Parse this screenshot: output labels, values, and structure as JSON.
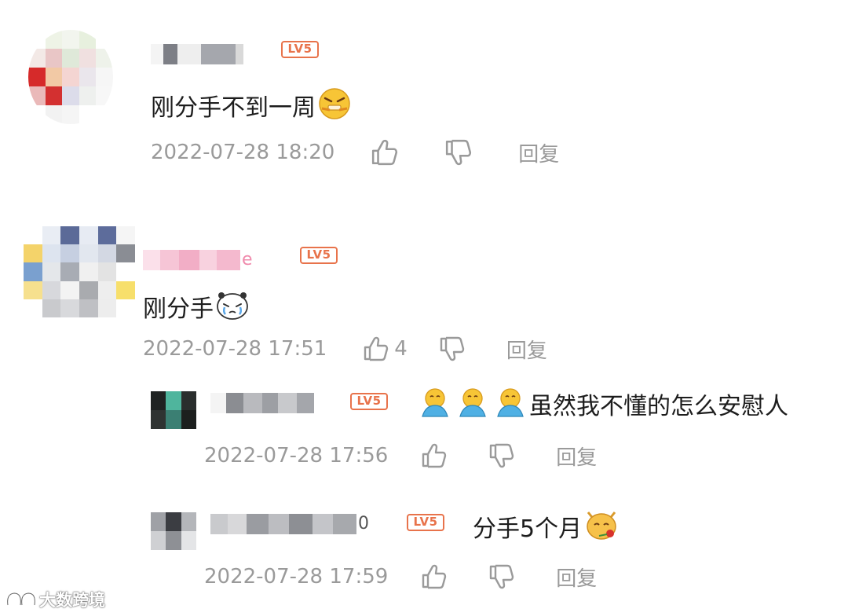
{
  "badge": "LV5",
  "comments": [
    {
      "user_suffix": "",
      "text": "刚分手不到一周",
      "emoji": "angry-bandaged-face-emoji",
      "time": "2022-07-28 18:20",
      "likes": "",
      "reply_label": "回复"
    },
    {
      "user_suffix": "e",
      "text": "刚分手",
      "emoji": "crying-panda-emoji",
      "time": "2022-07-28 17:51",
      "likes": "4",
      "reply_label": "回复"
    }
  ],
  "replies": [
    {
      "user_suffix": "",
      "text": "虽然我不懂的怎么安慰人",
      "emoji": "hug-emoji",
      "time": "2022-07-28 17:56",
      "reply_label": "回复"
    },
    {
      "user_suffix": "0",
      "text": "分手5个月",
      "emoji": "cat-with-rose-emoji",
      "time": "2022-07-28 17:59",
      "reply_label": "回复"
    }
  ],
  "watermark": "大数跨境",
  "colors": {
    "badge": "#e8734b",
    "meta": "#9a9a9a",
    "text": "#1d1d1d"
  }
}
